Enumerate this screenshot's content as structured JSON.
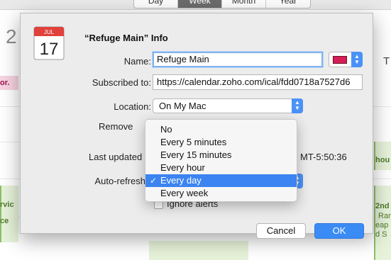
{
  "background": {
    "view_tabs": [
      "Day",
      "Week",
      "Month",
      "Year"
    ],
    "selected_tab": "Week",
    "day_number": "2",
    "column_head": "T",
    "pink_event": "or.",
    "left_events": [
      "rvic",
      "ce"
    ],
    "right_events": [
      "hou",
      "2nd",
      "Ran",
      "eap",
      "d S"
    ]
  },
  "dialog": {
    "title": "“Refuge Main” Info",
    "icon": {
      "month": "JUL",
      "day": "17",
      "name": "calendar-icon"
    },
    "name_label": "Name:",
    "name_value": "Refuge Main",
    "color": "#d61d55",
    "subscribed_label": "Subscribed to:",
    "subscribed_value": "https://calendar.zoho.com/ical/fdd0718a7527d6",
    "location_label": "Location:",
    "location_value": "On My Mac",
    "remove_label": "Remove",
    "last_updated_label": "Last updated",
    "last_updated_value": "MT-5:50:36",
    "autorefresh_label": "Auto-refresh",
    "ignore_alerts_label": "Ignore alerts",
    "cancel_label": "Cancel",
    "ok_label": "OK"
  },
  "refresh_menu": {
    "items": [
      "No",
      "Every 5 minutes",
      "Every 15 minutes",
      "Every hour",
      "Every day",
      "Every week"
    ],
    "selected": "Every day",
    "check": "✓"
  },
  "colors": {
    "accent": "#3b84f1",
    "ok_button": "#3b8bf5",
    "calendar_color": "#d61d55"
  }
}
